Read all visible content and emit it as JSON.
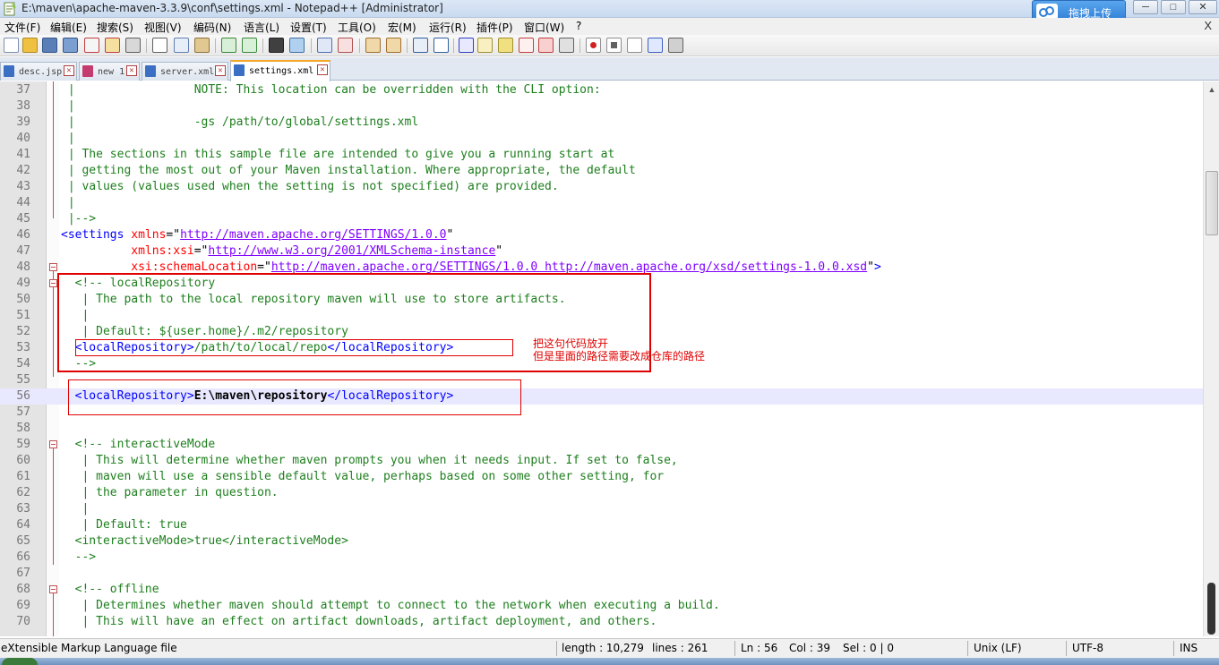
{
  "window": {
    "title": "E:\\maven\\apache-maven-3.3.9\\conf\\settings.xml - Notepad++ [Administrator]",
    "upload_button": "拖拽上传",
    "min_label": "─",
    "max_label": "□",
    "close_label": "✕"
  },
  "menu": [
    "文件(F)",
    "编辑(E)",
    "搜索(S)",
    "视图(V)",
    "编码(N)",
    "语言(L)",
    "设置(T)",
    "工具(O)",
    "宏(M)",
    "运行(R)",
    "插件(P)",
    "窗口(W)",
    "?"
  ],
  "menu_close": "X",
  "toolbar": {
    "icons": [
      "new-file-icon",
      "open-file-icon",
      "save-icon",
      "save-all-icon",
      "close-icon",
      "close-all-icon",
      "print-icon",
      "cut-icon",
      "copy-icon",
      "paste-icon",
      "undo-icon",
      "redo-icon",
      "find-icon",
      "replace-icon",
      "zoom-in-icon",
      "zoom-out-icon",
      "sync-v-icon",
      "sync-h-icon",
      "word-wrap-icon",
      "show-all-chars-icon",
      "indent-guide-icon",
      "lang-icon",
      "doc-map-icon",
      "function-list-icon",
      "folder-icon",
      "monitor-icon",
      "record-icon",
      "stop-icon",
      "play-icon",
      "play-multi-icon",
      "save-macro-icon"
    ]
  },
  "tabs": [
    {
      "label": "desc.jsp",
      "active": false,
      "color": "#3b6fc4"
    },
    {
      "label": "new 1",
      "active": false,
      "color": "#c43b6f"
    },
    {
      "label": "server.xml",
      "active": false,
      "color": "#3b6fc4"
    },
    {
      "label": "settings.xml",
      "active": true,
      "color": "#3b6fc4"
    }
  ],
  "editor": {
    "lines": [
      {
        "n": "37",
        "segs": [
          [
            "c",
            " |                 NOTE: This location can be overridden with the CLI option:"
          ]
        ]
      },
      {
        "n": "38",
        "segs": [
          [
            "c",
            " |"
          ]
        ]
      },
      {
        "n": "39",
        "segs": [
          [
            "c",
            " |                 -gs /path/to/global/settings.xml"
          ]
        ]
      },
      {
        "n": "40",
        "segs": [
          [
            "c",
            " |"
          ]
        ]
      },
      {
        "n": "41",
        "segs": [
          [
            "c",
            " | The sections in this sample file are intended to give you a running start at"
          ]
        ]
      },
      {
        "n": "42",
        "segs": [
          [
            "c",
            " | getting the most out of your Maven installation. Where appropriate, the default"
          ]
        ]
      },
      {
        "n": "43",
        "segs": [
          [
            "c",
            " | values (values used when the setting is not specified) are provided."
          ]
        ]
      },
      {
        "n": "44",
        "segs": [
          [
            "c",
            " |"
          ]
        ]
      },
      {
        "n": "45",
        "segs": [
          [
            "c",
            " |-->"
          ]
        ]
      },
      {
        "n": "46",
        "segs": [
          [
            "t",
            "<settings "
          ],
          [
            "a",
            "xmlns"
          ],
          [
            "x",
            "=\""
          ],
          [
            "v",
            "http://maven.apache.org/SETTINGS/1.0.0"
          ],
          [
            "x",
            "\""
          ]
        ]
      },
      {
        "n": "47",
        "segs": [
          [
            "x",
            "          "
          ],
          [
            "a",
            "xmlns:xsi"
          ],
          [
            "x",
            "=\""
          ],
          [
            "v",
            "http://www.w3.org/2001/XMLSchema-instance"
          ],
          [
            "x",
            "\""
          ]
        ]
      },
      {
        "n": "48",
        "segs": [
          [
            "x",
            "          "
          ],
          [
            "a",
            "xsi:schemaLocation"
          ],
          [
            "x",
            "=\""
          ],
          [
            "v",
            "http://maven.apache.org/SETTINGS/1.0.0 http://maven.apache.org/xsd/settings-1.0.0.xsd"
          ],
          [
            "x",
            "\""
          ],
          [
            "t",
            ">"
          ]
        ]
      },
      {
        "n": "49",
        "segs": [
          [
            "c",
            "  <!-- localRepository"
          ]
        ]
      },
      {
        "n": "50",
        "segs": [
          [
            "c",
            "   | The path to the local repository maven will use to store artifacts."
          ]
        ]
      },
      {
        "n": "51",
        "segs": [
          [
            "c",
            "   |"
          ]
        ]
      },
      {
        "n": "52",
        "segs": [
          [
            "c",
            "   | Default: ${user.home}/.m2/repository"
          ]
        ]
      },
      {
        "n": "53",
        "segs": [
          [
            "t",
            "  <localRepository>"
          ],
          [
            "c",
            "/path/to/local/repo"
          ],
          [
            "t",
            "</localRepository>"
          ]
        ]
      },
      {
        "n": "54",
        "segs": [
          [
            "c",
            "  -->"
          ]
        ]
      },
      {
        "n": "55",
        "segs": [
          [
            "x",
            ""
          ]
        ]
      },
      {
        "n": "56",
        "segs": [
          [
            "t",
            "  <localRepository>"
          ],
          [
            "b",
            "E:\\maven\\repository"
          ],
          [
            "t",
            "</localRepository>"
          ]
        ]
      },
      {
        "n": "57",
        "segs": [
          [
            "x",
            ""
          ]
        ]
      },
      {
        "n": "58",
        "segs": [
          [
            "x",
            ""
          ]
        ]
      },
      {
        "n": "59",
        "segs": [
          [
            "c",
            "  <!-- interactiveMode"
          ]
        ]
      },
      {
        "n": "60",
        "segs": [
          [
            "c",
            "   | This will determine whether maven prompts you when it needs input. If set to false,"
          ]
        ]
      },
      {
        "n": "61",
        "segs": [
          [
            "c",
            "   | maven will use a sensible default value, perhaps based on some other setting, for"
          ]
        ]
      },
      {
        "n": "62",
        "segs": [
          [
            "c",
            "   | the parameter in question."
          ]
        ]
      },
      {
        "n": "63",
        "segs": [
          [
            "c",
            "   |"
          ]
        ]
      },
      {
        "n": "64",
        "segs": [
          [
            "c",
            "   | Default: true"
          ]
        ]
      },
      {
        "n": "65",
        "segs": [
          [
            "c",
            "  <interactiveMode>true</interactiveMode>"
          ]
        ]
      },
      {
        "n": "66",
        "segs": [
          [
            "c",
            "  -->"
          ]
        ]
      },
      {
        "n": "67",
        "segs": [
          [
            "x",
            ""
          ]
        ]
      },
      {
        "n": "68",
        "segs": [
          [
            "c",
            "  <!-- offline"
          ]
        ]
      },
      {
        "n": "69",
        "segs": [
          [
            "c",
            "   | Determines whether maven should attempt to connect to the network when executing a build."
          ]
        ]
      },
      {
        "n": "70",
        "segs": [
          [
            "c",
            "   | This will have an effect on artifact downloads, artifact deployment, and others."
          ]
        ]
      }
    ],
    "current_line": "56",
    "annotation_line1": "把这句代码放开",
    "annotation_line2": "但是里面的路径需要改成仓库的路径"
  },
  "statusbar": {
    "filetype": "eXtensible Markup Language file",
    "length": "length : 10,279",
    "lines": "lines : 261",
    "ln": "Ln : 56",
    "col": "Col : 39",
    "sel": "Sel : 0 | 0",
    "eol": "Unix (LF)",
    "encoding": "UTF-8",
    "mode": "INS"
  }
}
